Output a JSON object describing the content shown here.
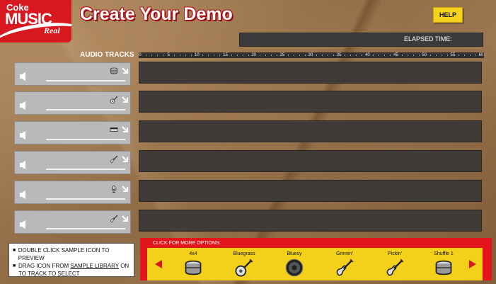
{
  "logo": {
    "line1": "Coke",
    "line2": "MUSIC",
    "line3": "Real"
  },
  "header": {
    "title": "Create Your Demo",
    "help_label": "HELP",
    "elapsed_label": "ELAPSED TIME:"
  },
  "tracks": {
    "label": "AUDIO TRACKS",
    "ticks": [
      "0",
      "5",
      "10",
      "15",
      "20",
      "25",
      "30",
      "35",
      "40",
      "45",
      "50",
      "55",
      "60"
    ],
    "items": [
      {
        "instrument": "drum-icon"
      },
      {
        "instrument": "banjo-icon"
      },
      {
        "instrument": "keyboard-icon"
      },
      {
        "instrument": "guitar-icon"
      },
      {
        "instrument": "microphone-icon"
      },
      {
        "instrument": "guitar-icon"
      }
    ]
  },
  "instructions": {
    "line1": "DOUBLE CLICK SAMPLE ICON TO PREVIEW",
    "line2a": "DRAG ICON FROM ",
    "line2b": "SAMPLE LIBRARY",
    "line2c": " ON",
    "line3": "TO TRACK TO SELECT"
  },
  "library": {
    "more_options": "CLICK FOR MORE OPTIONS:",
    "samples": [
      {
        "name": "4x4",
        "icon": "drum-icon"
      },
      {
        "name": "Bluegrass",
        "icon": "banjo-icon"
      },
      {
        "name": "Bluesy",
        "icon": "speaker-icon"
      },
      {
        "name": "Grinnin'",
        "icon": "guitar-icon"
      },
      {
        "name": "Pickin'",
        "icon": "guitar-icon"
      },
      {
        "name": "Shuffle 1",
        "icon": "drum-icon"
      }
    ]
  },
  "colors": {
    "brand_red": "#d7181f",
    "accent_yellow": "#f3d01a",
    "lane": "#3f3b37"
  }
}
